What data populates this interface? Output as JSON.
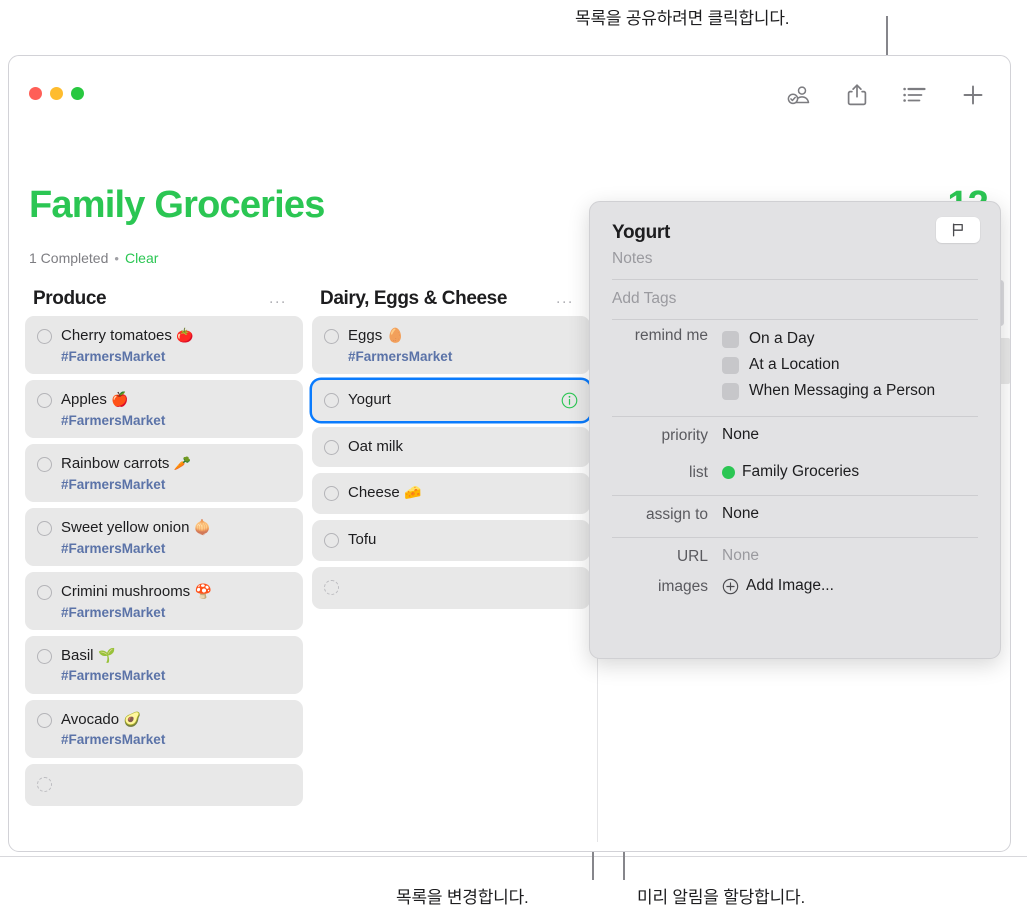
{
  "callouts": {
    "top": {
      "text": "목록을 공유하려면 클릭합니다."
    },
    "bottom_left": {
      "text": "목록을 변경합니다."
    },
    "bottom_right": {
      "text": "미리 알림을 할당합니다."
    }
  },
  "window": {
    "traffic_lights": [
      "close",
      "minimize",
      "zoom"
    ],
    "toolbar": {
      "assigned_label": "assigned-reminders",
      "share_label": "share",
      "view_label": "view-options",
      "add_label": "add-reminder"
    }
  },
  "list": {
    "title": "Family Groceries",
    "title_color": "#2bc653",
    "count_badge": "12",
    "completed_text": "1 Completed",
    "separator": "•",
    "clear_label": "Clear"
  },
  "columns": [
    {
      "name": "Produce",
      "menu": "...",
      "items": [
        {
          "title": "Cherry tomatoes",
          "emoji": "🍅",
          "tag": "#FarmersMarket",
          "selected": false,
          "placeholder": false
        },
        {
          "title": "Apples",
          "emoji": "🍎",
          "tag": "#FarmersMarket",
          "selected": false,
          "placeholder": false
        },
        {
          "title": "Rainbow carrots",
          "emoji": "🥕",
          "tag": "#FarmersMarket",
          "selected": false,
          "placeholder": false
        },
        {
          "title": "Sweet yellow onion",
          "emoji": "🧅",
          "tag": "#FarmersMarket",
          "selected": false,
          "placeholder": false
        },
        {
          "title": "Crimini mushrooms",
          "emoji": "🍄",
          "tag": "#FarmersMarket",
          "selected": false,
          "placeholder": false
        },
        {
          "title": "Basil",
          "emoji": "🌱",
          "tag": "#FarmersMarket",
          "selected": false,
          "placeholder": false
        },
        {
          "title": "Avocado",
          "emoji": "🥑",
          "tag": "#FarmersMarket",
          "selected": false,
          "placeholder": false
        },
        {
          "title": "",
          "emoji": "",
          "tag": "",
          "selected": false,
          "placeholder": true
        }
      ]
    },
    {
      "name": "Dairy, Eggs & Cheese",
      "menu": "...",
      "items": [
        {
          "title": "Eggs",
          "emoji": "🥚",
          "tag": "#FarmersMarket",
          "selected": false,
          "placeholder": false
        },
        {
          "title": "Yogurt",
          "emoji": "",
          "tag": "",
          "selected": true,
          "placeholder": false
        },
        {
          "title": "Oat milk",
          "emoji": "",
          "tag": "",
          "selected": false,
          "placeholder": false
        },
        {
          "title": "Cheese",
          "emoji": "🧀",
          "tag": "",
          "selected": false,
          "placeholder": false
        },
        {
          "title": "Tofu",
          "emoji": "",
          "tag": "",
          "selected": false,
          "placeholder": false
        },
        {
          "title": "",
          "emoji": "",
          "tag": "",
          "selected": false,
          "placeholder": true
        }
      ]
    }
  ],
  "popover": {
    "title": "Yogurt",
    "flag_icon": "flag-icon",
    "notes_placeholder": "Notes",
    "tags_placeholder": "Add Tags",
    "remind_me_label": "remind me",
    "remind_options": [
      {
        "label": "On a Day",
        "checked": false
      },
      {
        "label": "At a Location",
        "checked": false
      },
      {
        "label": "When Messaging a Person",
        "checked": false
      }
    ],
    "priority_label": "priority",
    "priority_value": "None",
    "list_label": "list",
    "list_value": "Family Groceries",
    "list_color": "#2bc653",
    "assign_label": "assign to",
    "assign_value": "None",
    "url_label": "URL",
    "url_value": "None",
    "images_label": "images",
    "images_value": "Add Image..."
  }
}
